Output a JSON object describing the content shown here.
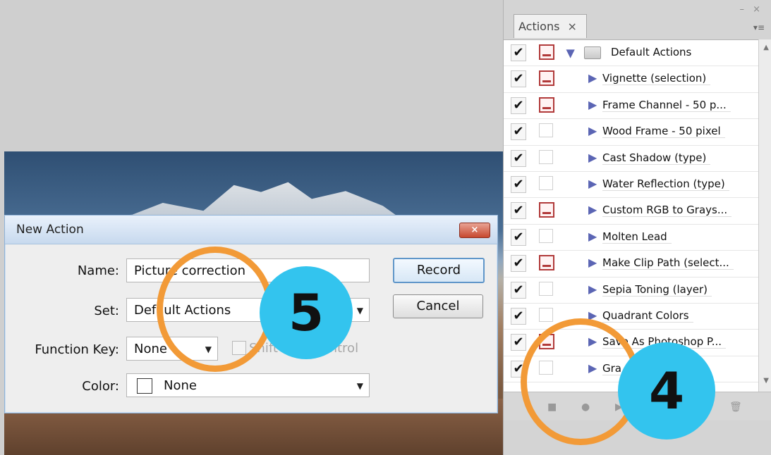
{
  "panel": {
    "tab_label": "Actions",
    "tab_close": "×",
    "window_controls": "– ×",
    "menu_icon": "▾≡",
    "set": {
      "label": "Default Actions",
      "checked": true,
      "dialog_on": true
    },
    "actions": [
      {
        "label": "Vignette (selection)",
        "checked": true,
        "dialog_on": true
      },
      {
        "label": "Frame Channel - 50 p...",
        "checked": true,
        "dialog_on": true
      },
      {
        "label": "Wood Frame - 50 pixel",
        "checked": true,
        "dialog_on": false
      },
      {
        "label": "Cast Shadow (type)",
        "checked": true,
        "dialog_on": false
      },
      {
        "label": "Water Reflection (type)",
        "checked": true,
        "dialog_on": false
      },
      {
        "label": "Custom RGB to Grays...",
        "checked": true,
        "dialog_on": true
      },
      {
        "label": "Molten Lead",
        "checked": true,
        "dialog_on": false
      },
      {
        "label": "Make Clip Path (select...",
        "checked": true,
        "dialog_on": true
      },
      {
        "label": "Sepia Toning (layer)",
        "checked": true,
        "dialog_on": false
      },
      {
        "label": "Quadrant Colors",
        "checked": true,
        "dialog_on": false
      },
      {
        "label": "Save As Photoshop P...",
        "checked": true,
        "dialog_on": true
      },
      {
        "label": "Gra",
        "checked": true,
        "dialog_on": false
      }
    ],
    "bottom_buttons": [
      "stop-button",
      "record-button",
      "play-button",
      "delete-button"
    ]
  },
  "dialog": {
    "title": "New Action",
    "close_label": "×",
    "name_label": "Name:",
    "name_value": "Picture correction",
    "set_label": "Set:",
    "set_value": "Default Actions",
    "function_key_label": "Function Key:",
    "function_key_value": "None",
    "shift_label": "Shift",
    "control_label": "Control",
    "color_label": "Color:",
    "color_value": "None",
    "record_label": "Record",
    "cancel_label": "Cancel"
  },
  "annotations": {
    "step5": "5",
    "step4": "4",
    "ring_color": "#f29a37",
    "badge_color": "#33c4ee"
  }
}
